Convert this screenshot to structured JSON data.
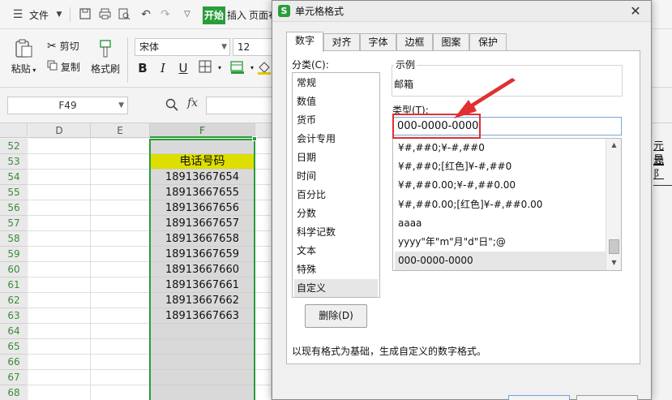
{
  "menubar": {
    "file_label": "文件",
    "start_tab": "开始",
    "insert_tab": "插入",
    "page_tab": "页面布"
  },
  "ribbon": {
    "paste_label": "粘贴",
    "cut_label": "剪切",
    "copy_label": "复制",
    "format_painter_label": "格式刷",
    "font_name": "宋体",
    "font_size": "12"
  },
  "formula_bar": {
    "name_box": "F49",
    "fx_label": "fx"
  },
  "sheet": {
    "columns": [
      "D",
      "E",
      "F"
    ],
    "rows": [
      "52",
      "53",
      "54",
      "55",
      "56",
      "57",
      "58",
      "59",
      "60",
      "61",
      "62",
      "63",
      "64",
      "65",
      "66",
      "67",
      "68"
    ],
    "f_cells": [
      "",
      "电话号码",
      "18913667654",
      "18913667655",
      "18913667656",
      "18913667657",
      "18913667658",
      "18913667659",
      "18913667660",
      "18913667661",
      "18913667662",
      "18913667663",
      "",
      "",
      "",
      "",
      ""
    ],
    "right_text": [
      "元恳",
      "元阝"
    ]
  },
  "dialog": {
    "title": "单元格格式",
    "close_glyph": "✕",
    "tabs": [
      "数字",
      "对齐",
      "字体",
      "边框",
      "图案",
      "保护"
    ],
    "category_label": "分类(C):",
    "categories": [
      "常规",
      "数值",
      "货币",
      "会计专用",
      "日期",
      "时间",
      "百分比",
      "分数",
      "科学记数",
      "文本",
      "特殊",
      "自定义"
    ],
    "sample_label": "示例",
    "sample_value": "邮箱",
    "type_label": "类型(T):",
    "type_value": "000-0000-0000",
    "format_list": [
      "¥#,##0;¥-#,##0",
      "¥#,##0;[红色]¥-#,##0",
      "¥#,##0.00;¥-#,##0.00",
      "¥#,##0.00;[红色]¥-#,##0.00",
      "aaaa",
      "yyyy\"年\"m\"月\"d\"日\";@",
      "000-0000-0000"
    ],
    "delete_button": "删除(D)",
    "description": "以现有格式为基础，生成自定义的数字格式。"
  },
  "colors": {
    "accent_green": "#2a9d3b",
    "header_highlight": "#dede00",
    "annotation_red": "#e03030"
  }
}
